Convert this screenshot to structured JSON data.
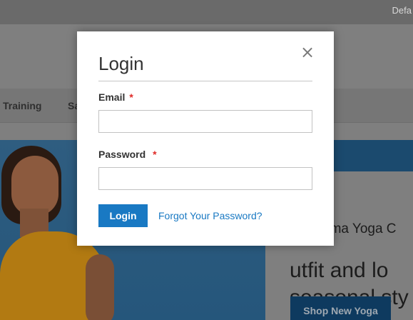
{
  "background": {
    "topbar_text": "Defa",
    "nav": {
      "training": "Training",
      "sale": "Sa"
    },
    "hero": {
      "subtitle": "uma Yoga C",
      "title_line1": "utfit and lo",
      "title_line2": "seasonal sty",
      "shop_button": "Shop New Yoga"
    }
  },
  "modal": {
    "title": "Login",
    "close_symbol": "×",
    "email": {
      "label": "Email",
      "required_mark": "*",
      "value": "",
      "placeholder": ""
    },
    "password": {
      "label": "Password",
      "required_mark": "*",
      "value": "",
      "placeholder": ""
    },
    "login_button": "Login",
    "forgot_link": "Forgot Your Password?"
  },
  "colors": {
    "accent": "#1979c3",
    "required": "#e02b27",
    "overlay_dim": "#7f7f7f"
  },
  "icons": {
    "close": "close-icon"
  }
}
